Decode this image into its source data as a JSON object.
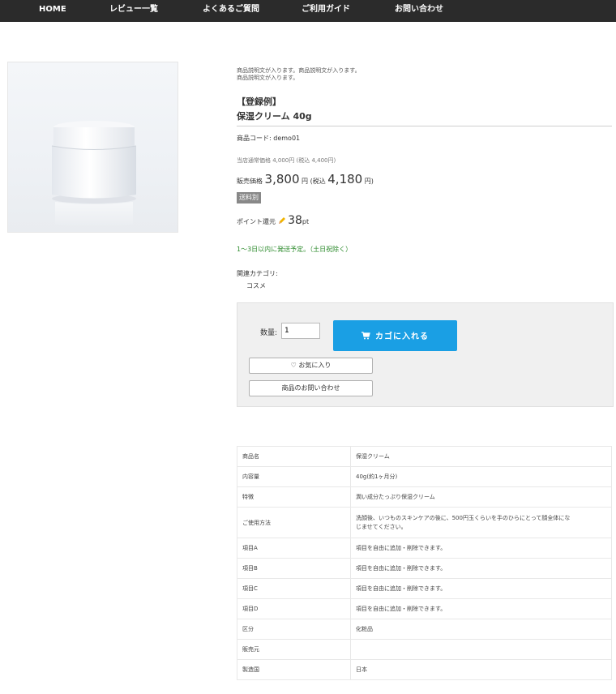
{
  "nav": {
    "items": [
      "HOME",
      "レビュー一覧",
      "よくあるご質問",
      "ご利用ガイド",
      "お問い合わせ"
    ]
  },
  "product": {
    "image_alt": "white cream jar",
    "description_line1": "商品説明文が入ります。商品説明文が入ります。",
    "description_line2": "商品説明文が入ります。",
    "registration": "【登録例】",
    "name": "保湿クリーム 40g",
    "code_label": "商品コード: ",
    "code_value": "demo01",
    "regular_price_text": "当店通常価格 4,000円 (税込 4,400円)",
    "sale_label": "販売価格 ",
    "sale_price": "3,800",
    "sale_yen": " 円",
    "tax_open": " (税込 ",
    "tax_price": "4,180",
    "tax_close": " 円)",
    "shipping_badge": "送料別",
    "points_label": "ポイント還元 ",
    "points_value": "38",
    "points_unit": "pt",
    "ship_note": "1〜3日以内に発送予定。（土日祝除く）",
    "category_label": "関連カテゴリ:",
    "category": "コスメ"
  },
  "cart": {
    "qty_label": "数量:",
    "qty_value": "1",
    "add_button": "カゴに入れる",
    "favorite_button": "♡ お気に入り",
    "inquiry_button": "商品のお問い合わせ"
  },
  "specs": [
    {
      "key": "商品名",
      "value": "保湿クリーム"
    },
    {
      "key": "内容量",
      "value": "40g(約1ヶ月分)"
    },
    {
      "key": "特徴",
      "value": "潤い成分たっぷり保湿クリーム"
    },
    {
      "key": "ご使用方法",
      "value": "洗顔後、いつものスキンケアの後に、500円玉くらいを手のひらにとって顔全体にな",
      "value2": "じませてください。"
    },
    {
      "key": "項目A",
      "value": "項目を自由に追加・削除できます。"
    },
    {
      "key": "項目B",
      "value": "項目を自由に追加・削除できます。"
    },
    {
      "key": "項目C",
      "value": "項目を自由に追加・削除できます。"
    },
    {
      "key": "項目D",
      "value": "項目を自由に追加・削除できます。"
    },
    {
      "key": "区分",
      "value": "化粧品"
    },
    {
      "key": "販売元",
      "value": ""
    },
    {
      "key": "製造国",
      "value": "日本"
    }
  ],
  "colors": {
    "nav_bg": "#2b2b2b",
    "cart_button": "#1a9fe4",
    "ship_note": "#2b8a2b",
    "badge_bg": "#888888"
  }
}
